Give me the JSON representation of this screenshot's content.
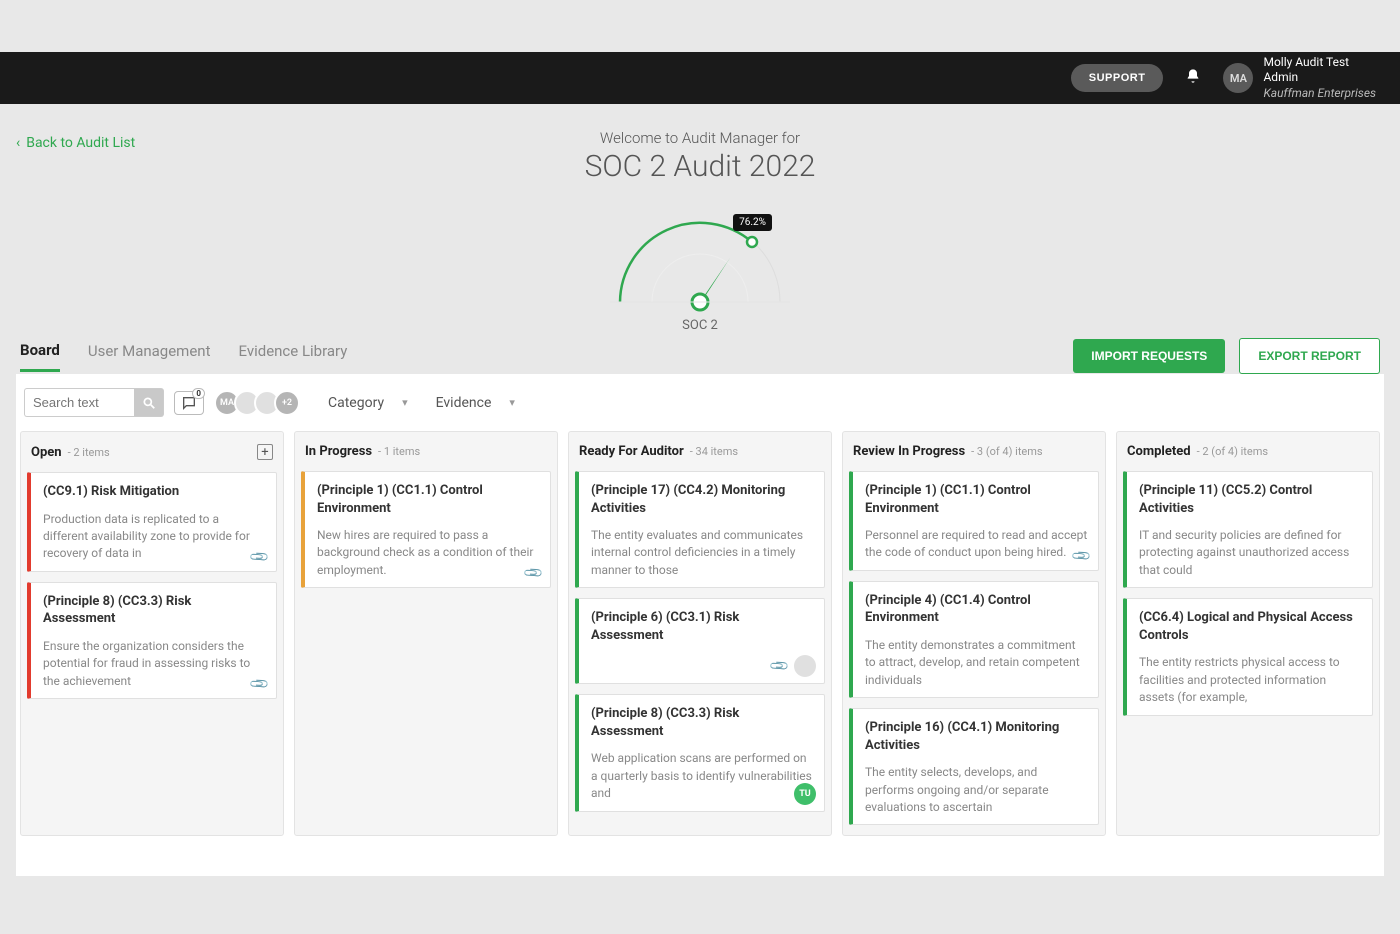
{
  "header": {
    "support_label": "SUPPORT",
    "avatar_initials": "MA",
    "user_name": "Molly Audit Test",
    "user_role": "Admin",
    "user_org": "Kauffman Enterprises"
  },
  "nav": {
    "back_label": "Back to Audit List"
  },
  "welcome": {
    "subtitle": "Welcome to Audit Manager for",
    "title": "SOC 2 Audit 2022"
  },
  "gauge": {
    "percent_label": "76.2%",
    "framework_label": "SOC 2",
    "value_fraction": 0.762
  },
  "tabs": {
    "board": "Board",
    "user_management": "User Management",
    "evidence_library": "Evidence Library"
  },
  "actions": {
    "import": "IMPORT REQUESTS",
    "export": "EXPORT REPORT"
  },
  "toolbar": {
    "search_placeholder": "Search text",
    "comment_count": "0",
    "avatar1": "MA",
    "avatar_more": "+2",
    "filter_category": "Category",
    "filter_evidence": "Evidence"
  },
  "columns": [
    {
      "title": "Open",
      "count": "- 2 items",
      "show_add": true,
      "cards": [
        {
          "color": "red",
          "title": "(CC9.1) Risk Mitigation",
          "desc": "Production data is replicated to a different availability zone to provide for recovery of data in",
          "clip": true
        },
        {
          "color": "red",
          "title": "(Principle 8) (CC3.3) Risk Assessment",
          "desc": "Ensure the organization considers the potential for fraud in assessing risks to the achievement",
          "clip": true
        }
      ]
    },
    {
      "title": "In Progress",
      "count": "- 1 items",
      "cards": [
        {
          "color": "orange",
          "title": "(Principle 1) (CC1.1) Control Environment",
          "desc": "New hires are required to pass a background check as a condition of their employment.",
          "clip": true
        }
      ]
    },
    {
      "title": "Ready For Auditor",
      "count": "- 34 items",
      "cards": [
        {
          "color": "green",
          "title": "(Principle 17) (CC4.2) Monitoring Activities",
          "desc": "The entity evaluates and communicates internal control deficiencies in a timely manner to those"
        },
        {
          "color": "green",
          "title": "(Principle 6) (CC3.1) Risk Assessment",
          "desc": "",
          "clip": true,
          "avatar_gray": true
        },
        {
          "color": "green",
          "title": "(Principle 8) (CC3.3) Risk Assessment",
          "desc": "Web application scans are performed on a quarterly basis to identify vulnerabilities and",
          "avatar_tu": "TU"
        }
      ]
    },
    {
      "title": "Review In Progress",
      "count": "- 3 (of 4) items",
      "cards": [
        {
          "color": "green",
          "title": "(Principle 1) (CC1.1) Control Environment",
          "desc": "Personnel are required to read and accept the code of conduct upon being hired.",
          "clip": true
        },
        {
          "color": "green",
          "title": "(Principle 4) (CC1.4) Control Environment",
          "desc": "The entity demonstrates a commitment to attract, develop, and retain competent individuals"
        },
        {
          "color": "green",
          "title": "(Principle 16) (CC4.1) Monitoring Activities",
          "desc": "The entity selects, develops, and performs ongoing and/or separate evaluations to ascertain"
        }
      ]
    },
    {
      "title": "Completed",
      "count": "- 2 (of 4) items",
      "cards": [
        {
          "color": "green",
          "title": "(Principle 11) (CC5.2) Control Activities",
          "desc": "IT and security policies are defined for protecting against unauthorized access that could"
        },
        {
          "color": "green",
          "title": "(CC6.4) Logical and Physical Access Controls",
          "desc": "The entity restricts physical access to facilities and protected information assets (for example,"
        }
      ]
    }
  ]
}
